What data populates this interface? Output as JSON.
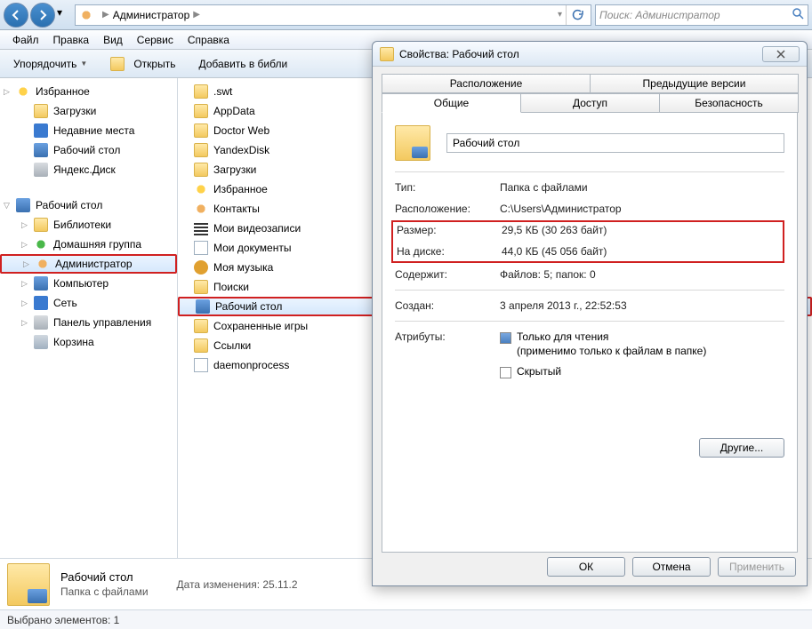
{
  "nav": {
    "breadcrumb_root": "Администратор",
    "search_placeholder": "Поиск: Администратор"
  },
  "menu": [
    "Файл",
    "Правка",
    "Вид",
    "Сервис",
    "Справка"
  ],
  "toolbar": {
    "organize": "Упорядочить",
    "open": "Открыть",
    "add_lib": "Добавить в библи"
  },
  "tree": {
    "favorites": {
      "title": "Избранное",
      "items": [
        "Загрузки",
        "Недавние места",
        "Рабочий стол",
        "Яндекс.Диск"
      ]
    },
    "desktop": {
      "title": "Рабочий стол",
      "items": [
        "Библиотеки",
        "Домашняя группа",
        "Администратор",
        "Компьютер",
        "Сеть",
        "Панель управления",
        "Корзина"
      ]
    }
  },
  "content": [
    ".swt",
    "AppData",
    "Doctor Web",
    "YandexDisk",
    "Загрузки",
    "Избранное",
    "Контакты",
    "Мои видеозаписи",
    "Мои документы",
    "Моя музыка",
    "Поиски",
    "Рабочий стол",
    "Сохраненные игры",
    "Ссылки",
    "daemonprocess"
  ],
  "details": {
    "title": "Рабочий стол",
    "type": "Папка с файлами",
    "mod_label": "Дата изменения:",
    "mod_value": "25.11.2"
  },
  "status": "Выбрано элементов: 1",
  "dialog": {
    "title": "Свойства: Рабочий стол",
    "tabs_row1": [
      "Расположение",
      "Предыдущие версии"
    ],
    "tabs_row2": [
      "Общие",
      "Доступ",
      "Безопасность"
    ],
    "name": "Рабочий стол",
    "rows": {
      "type_label": "Тип:",
      "type_value": "Папка с файлами",
      "loc_label": "Расположение:",
      "loc_value": "C:\\Users\\Администратор",
      "size_label": "Размер:",
      "size_value": "29,5 КБ (30 263 байт)",
      "disk_label": "На диске:",
      "disk_value": "44,0 КБ (45 056 байт)",
      "contains_label": "Содержит:",
      "contains_value": "Файлов: 5; папок: 0",
      "created_label": "Создан:",
      "created_value": "3 апреля 2013 г., 22:52:53",
      "attr_label": "Атрибуты:",
      "readonly": "Только для чтения",
      "readonly_note": "(применимо только к файлам в папке)",
      "hidden": "Скрытый",
      "others": "Другие..."
    },
    "buttons": {
      "ok": "ОК",
      "cancel": "Отмена",
      "apply": "Применить"
    }
  }
}
